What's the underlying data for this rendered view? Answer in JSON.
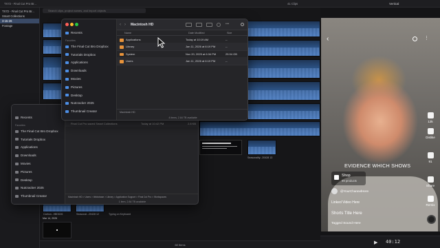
{
  "fcp": {
    "library_rows": [
      "TX72 - Final Cut Pro Br...",
      "Smart Collections",
      "3-15-26",
      "Footage"
    ],
    "search_placeholder": "Search clips, project names, and import objects",
    "status_bar": "68 Items",
    "viewer_zoom": "Vertical",
    "clips_count": "41 Clips",
    "captions": [
      "Carbon...9BDD26",
      "Seasonal...20428 12",
      "Typing on Keyboard",
      "Mar 14, 2026",
      "Seasonality...20428 13",
      "Final Cut Pro saved Smart Collections"
    ],
    "date_badge": "Mar 14, 2026"
  },
  "finder_front": {
    "title": "Macintosh HD",
    "columns": {
      "name": "Name",
      "modified": "Date Modified",
      "size": "Size"
    },
    "sidebar": [
      {
        "label": "Recents",
        "icon": "clock-icon"
      },
      {
        "section": "Favorites"
      },
      {
        "label": "The Final Cut Bro Dropbox",
        "icon": "dropbox-icon"
      },
      {
        "label": "Tutorials Dropbox",
        "icon": "dropbox-icon"
      },
      {
        "label": "Applications",
        "icon": "applications-icon"
      },
      {
        "label": "Downloads",
        "icon": "downloads-icon"
      },
      {
        "label": "Movies",
        "icon": "movies-icon"
      },
      {
        "label": "Pictures",
        "icon": "pictures-icon"
      },
      {
        "label": "Desktop",
        "icon": "desktop-icon"
      },
      {
        "label": "Nutcracker 2025",
        "icon": "folder-icon"
      },
      {
        "label": "Thumbnail Creator",
        "icon": "folder-icon"
      }
    ],
    "rows": [
      {
        "name": "Applications",
        "modified": "Today at 10:19 AM",
        "size": "--"
      },
      {
        "name": "Library",
        "modified": "Jan 11, 2026 at 6:19 PM",
        "size": "--"
      },
      {
        "name": "System",
        "modified": "Nov 20, 2025 at 6:34 PM",
        "size": "25.94 GB"
      },
      {
        "name": "Users",
        "modified": "Jan 11, 2026 at 6:19 PM",
        "size": "--"
      }
    ],
    "path": "Macintosh HD",
    "status": "4 items, 2.84 TB available"
  },
  "finder_back": {
    "sidebar": [
      {
        "label": "Recents"
      },
      {
        "section": "Favorites"
      },
      {
        "label": "The Final Cut Bro Dropbox"
      },
      {
        "label": "Tutorials Dropbox"
      },
      {
        "label": "Applications"
      },
      {
        "label": "Downloads"
      },
      {
        "label": "Movies"
      },
      {
        "label": "Pictures"
      },
      {
        "label": "Desktop"
      },
      {
        "label": "Nutcracker 2025"
      },
      {
        "label": "Thumbnail Creator"
      }
    ],
    "row_name": "Final Cut Pro saved Smart Collections",
    "row_date": "Today at 10:42 PM",
    "row_size": "2.8 KB",
    "path": "Macintosh HD > Users > tbfotobase > Library > Application Support > Final Cut Pro > Workspaces",
    "status": "1 item, 2.84 TB available"
  },
  "tiktok": {
    "overlay_text": "EVIDENCE WHICH SHOWS",
    "shop_label": "Shop",
    "shop_sub": "99 products",
    "username": "@YourChannelHere",
    "link": "Linked Video Here",
    "title": "Shorts Title Here",
    "sound": "Tagged Sound Here",
    "likes": "12k",
    "dislike": "Dislike",
    "comments": "91",
    "share": "Share",
    "remix": "Remix",
    "timecode": "40:12"
  },
  "colors": {
    "accent": "#3a4a66",
    "folder": "#e8933a",
    "clip": "#2a4f80"
  }
}
